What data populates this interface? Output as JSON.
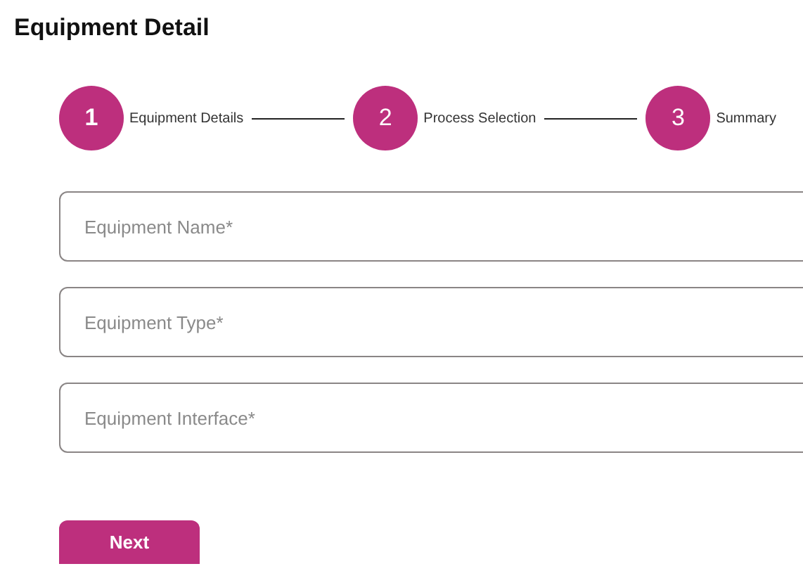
{
  "title": "Equipment Detail",
  "steps": [
    {
      "number": "1",
      "label": "Equipment Details",
      "selected": true
    },
    {
      "number": "2",
      "label": "Process Selection",
      "selected": false
    },
    {
      "number": "3",
      "label": "Summary",
      "selected": false
    }
  ],
  "fields": [
    {
      "placeholder": "Equipment Name*"
    },
    {
      "placeholder": "Equipment Type*"
    },
    {
      "placeholder": "Equipment Interface*"
    }
  ],
  "button": "Next"
}
